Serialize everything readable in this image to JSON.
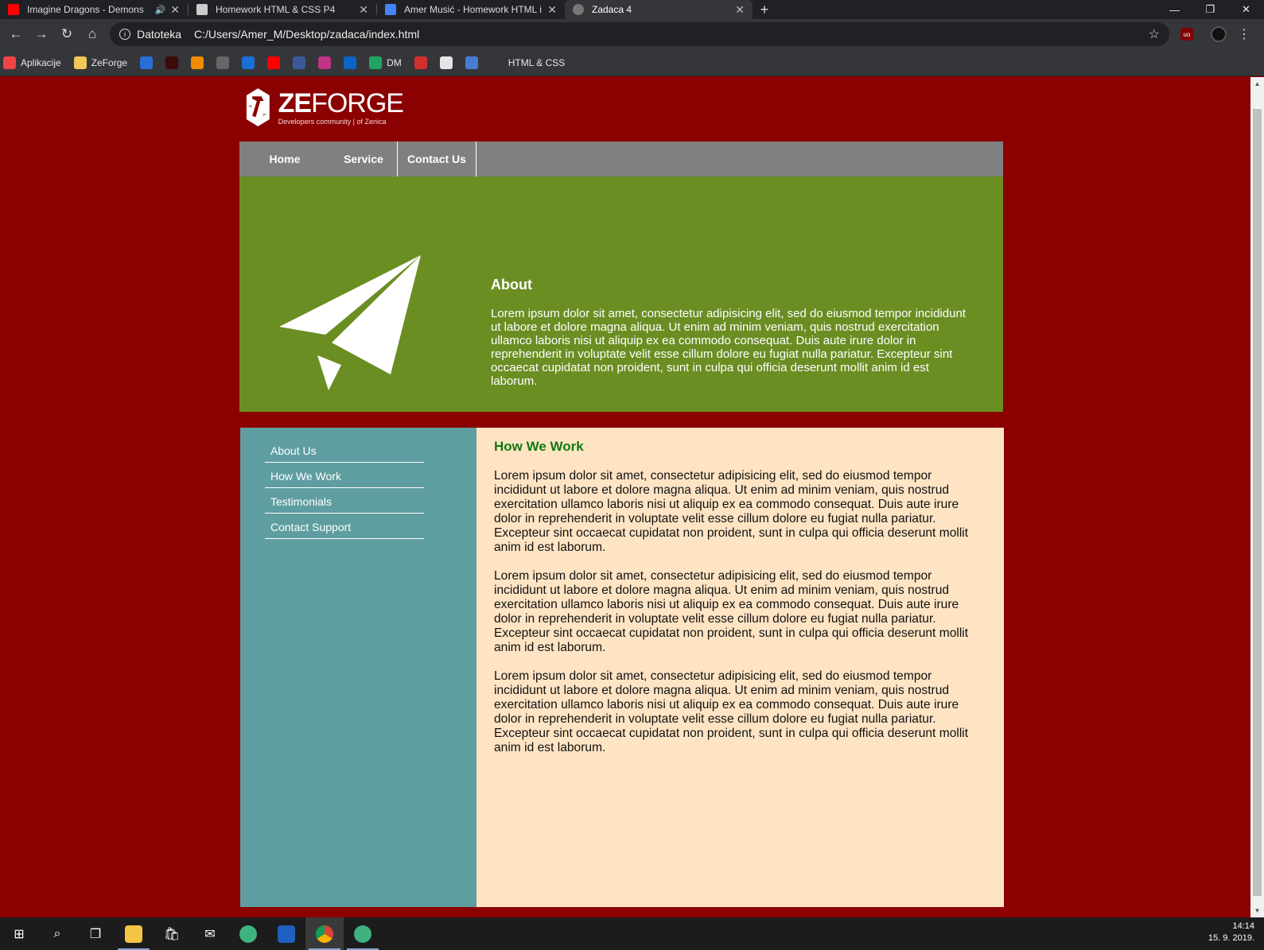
{
  "browser": {
    "tabs": [
      {
        "title": "Imagine Dragons - Demons",
        "favicon_color": "#ff0000",
        "audio": true,
        "active": false
      },
      {
        "title": "Homework HTML & CSS P4",
        "favicon_color": "#cccccc",
        "audio": false,
        "active": false
      },
      {
        "title": "Amer Musić - Homework HTML i",
        "favicon_color": "#4285f4",
        "audio": false,
        "active": false
      },
      {
        "title": "Zadaca 4",
        "favicon_color": "#777777",
        "audio": false,
        "active": true
      }
    ],
    "new_tab": "+",
    "scheme_label": "Datoteka",
    "url": "C:/Users/Amer_M/Desktop/zadaca/index.html",
    "bookmarks": [
      {
        "label": "Aplikacije",
        "icon": "apps-grid-icon",
        "color": "#e44"
      },
      {
        "label": "ZeForge",
        "icon": "folder-icon",
        "color": "#f1c75a"
      },
      {
        "label": "",
        "icon": "music-icon",
        "color": "#2a6fd6"
      },
      {
        "label": "",
        "icon": "jobs-icon",
        "color": "#3b0b0b"
      },
      {
        "label": "",
        "icon": "orange-blocks-icon",
        "color": "#f08c00"
      },
      {
        "label": "",
        "icon": "globe-icon",
        "color": "#666"
      },
      {
        "label": "",
        "icon": "cloud-icon",
        "color": "#1b6ed6"
      },
      {
        "label": "",
        "icon": "youtube-icon",
        "color": "#ff0000"
      },
      {
        "label": "",
        "icon": "facebook-icon",
        "color": "#3b5998"
      },
      {
        "label": "",
        "icon": "instagram-icon",
        "color": "#c13584"
      },
      {
        "label": "",
        "icon": "onedrive-icon",
        "color": "#0a64c8"
      },
      {
        "label": "DM",
        "icon": "drive-icon",
        "color": "#1fa463"
      },
      {
        "label": "",
        "icon": "pdf-icon",
        "color": "#d32f2f"
      },
      {
        "label": "",
        "icon": "health-icon",
        "color": "#e5e5e5"
      },
      {
        "label": "",
        "icon": "translate-icon",
        "color": "#4a7bd6"
      },
      {
        "label": "HTML & CSS",
        "icon": "wifi-icon",
        "color": "#35363a"
      }
    ]
  },
  "site": {
    "logo": {
      "brand_bold": "ZE",
      "brand_rest": "FORGE",
      "tagline": "Developers community | of Zenica"
    },
    "nav": [
      "Home",
      "Service",
      "Contact Us"
    ],
    "hero": {
      "title": "About",
      "text": "Lorem ipsum dolor sit amet, consectetur adipisicing elit, sed do eiusmod tempor incididunt ut labore et dolore magna aliqua. Ut enim ad minim veniam, quis nostrud exercitation ullamco laboris nisi ut aliquip ex ea commodo consequat. Duis aute irure dolor in reprehenderit in voluptate velit esse cillum dolore eu fugiat nulla pariatur. Excepteur sint occaecat cupidatat non proident, sunt in culpa qui officia deserunt mollit anim id est laborum."
    },
    "sidebar": [
      "About Us",
      "How We Work",
      "Testimonials",
      "Contact Support"
    ],
    "main": {
      "title": "How We Work",
      "paragraphs": [
        "Lorem ipsum dolor sit amet, consectetur adipisicing elit, sed do eiusmod tempor incididunt ut labore et dolore magna aliqua. Ut enim ad minim veniam, quis nostrud exercitation ullamco laboris nisi ut aliquip ex ea commodo consequat. Duis aute irure dolor in reprehenderit in voluptate velit esse cillum dolore eu fugiat nulla pariatur. Excepteur sint occaecat cupidatat non proident, sunt in culpa qui officia deserunt mollit anim id est laborum.",
        "Lorem ipsum dolor sit amet, consectetur adipisicing elit, sed do eiusmod tempor incididunt ut labore et dolore magna aliqua. Ut enim ad minim veniam, quis nostrud exercitation ullamco laboris nisi ut aliquip ex ea commodo consequat. Duis aute irure dolor in reprehenderit in voluptate velit esse cillum dolore eu fugiat nulla pariatur. Excepteur sint occaecat cupidatat non proident, sunt in culpa qui officia deserunt mollit anim id est laborum.",
        "Lorem ipsum dolor sit amet, consectetur adipisicing elit, sed do eiusmod tempor incididunt ut labore et dolore magna aliqua. Ut enim ad minim veniam, quis nostrud exercitation ullamco laboris nisi ut aliquip ex ea commodo consequat. Duis aute irure dolor in reprehenderit in voluptate velit esse cillum dolore eu fugiat nulla pariatur. Excepteur sint occaecat cupidatat non proident, sunt in culpa qui officia deserunt mollit anim id est laborum."
      ]
    }
  },
  "colors": {
    "page_bg": "#8b0000",
    "nav_bg": "#808080",
    "hero_bg": "#6b8e23",
    "sidebar_bg": "#5f9ea0",
    "main_bg": "#ffe4c4",
    "main_title": "#117a11"
  },
  "taskbar": {
    "items": [
      {
        "name": "start-icon",
        "color": "#ffffff"
      },
      {
        "name": "search-icon",
        "color": "#ffffff"
      },
      {
        "name": "task-view-icon",
        "color": "#ffffff"
      },
      {
        "name": "file-explorer-icon",
        "color": "#f4c542"
      },
      {
        "name": "store-icon",
        "color": "#ffffff"
      },
      {
        "name": "mail-icon",
        "color": "#ffffff"
      },
      {
        "name": "atom-icon",
        "color": "#3fb27f"
      },
      {
        "name": "dev-icon",
        "color": "#1f5fbf"
      },
      {
        "name": "chrome-icon",
        "color": "#db4437"
      },
      {
        "name": "atom-icon-2",
        "color": "#3fb27f"
      }
    ],
    "time": "14:14",
    "date": "15. 9. 2019."
  }
}
